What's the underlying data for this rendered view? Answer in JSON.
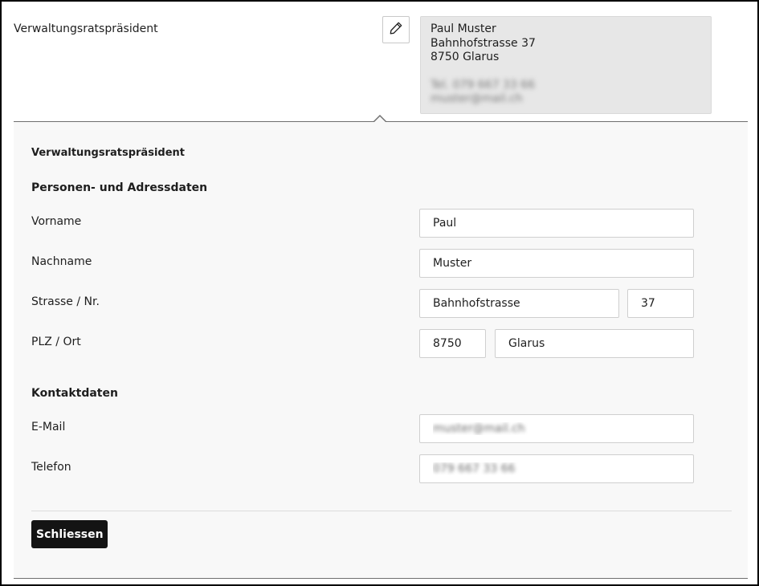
{
  "row": {
    "label": "Verwaltungsratspräsident",
    "edit_icon": "pencil-icon"
  },
  "summary": {
    "name": "Paul Muster",
    "street": "Bahnhofstrasse 37",
    "city": "8750 Glarus",
    "phone_blurred": "Tel. 079 667 33 66",
    "email_blurred": "muster@mail.ch"
  },
  "panel": {
    "title": "Verwaltungsratspräsident",
    "section_person": "Personen- und Adressdaten",
    "section_contact": "Kontaktdaten",
    "labels": {
      "vorname": "Vorname",
      "nachname": "Nachname",
      "strasse": "Strasse / Nr.",
      "plz_ort": "PLZ / Ort",
      "email": "E-Mail",
      "telefon": "Telefon"
    },
    "values": {
      "vorname": "Paul",
      "nachname": "Muster",
      "strasse": "Bahnhofstrasse",
      "nr": "37",
      "plz": "8750",
      "ort": "Glarus",
      "email": "muster@mail.ch",
      "telefon": "079 667 33 66"
    },
    "close_label": "Schliessen"
  },
  "colors": {
    "panel_bg": "#f8f8f8",
    "summary_bg": "#e7e7e7",
    "primary_button": "#141414"
  }
}
